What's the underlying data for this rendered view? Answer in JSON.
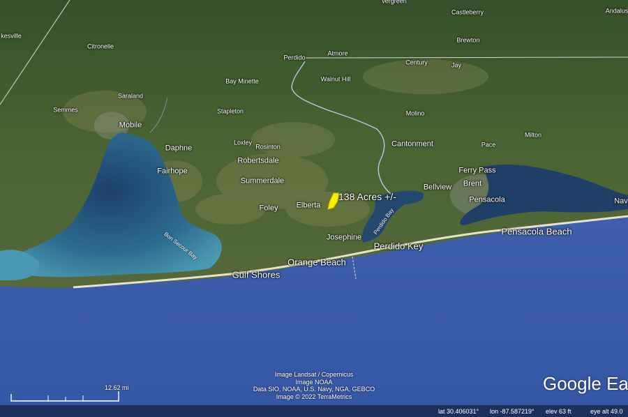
{
  "map": {
    "places": {
      "saraland": "Saraland",
      "semmes": "Semmes",
      "mobile": "Mobile",
      "citronelle": "Citronelle",
      "daphne": "Daphne",
      "fairhope": "Fairhope",
      "bay_minette": "Bay Minette",
      "stapleton": "Stapleton",
      "loxley": "Loxley",
      "rosinton": "Rosinton",
      "robertsdale": "Robertsdale",
      "summerdale": "Summerdale",
      "foley": "Foley",
      "elberta": "Elberta",
      "josephine": "Josephine",
      "orange_beach": "Orange Beach",
      "gulf_shores": "Gulf Shores",
      "perdido_key": "Perdido Key",
      "perdido": "Perdido",
      "atmore": "Atmore",
      "walnut_hill": "Walnut Hill",
      "century": "Century",
      "jay": "Jay",
      "molino": "Molino",
      "cantonment": "Cantonment",
      "milton": "Milton",
      "pace": "Pace",
      "ferry_pass": "Ferry Pass",
      "brent": "Brent",
      "bellview": "Bellview",
      "pensacola": "Pensacola",
      "pensacola_beach": "Pensacola Beach",
      "navarre": "Nav",
      "castleberry": "Castleberry",
      "brewton": "Brewton",
      "andalusia": "Andalus",
      "evergreen": "vergreen",
      "leakesville": "kesville",
      "bon_secour_bay": "Bon Secour Bay",
      "perdido_bay": "Perdido Bay"
    },
    "placemark": {
      "label": "138 Acres +/-",
      "color": "#f4f000"
    },
    "attribution": [
      "Image Landsat / Copernicus",
      "Image NOAA",
      "Data SIO, NOAA, U.S. Navy, NGA, GEBCO",
      "Image © 2022 TerraMetrics"
    ],
    "scale_label": "12.62 mi",
    "logo": "Google Earth"
  },
  "status": {
    "lat": "lat  30.406031°",
    "lon": "lon  -87.587219°",
    "elev": "elev    63 ft",
    "eye": "eye alt  49.0"
  },
  "colors": {
    "ocean": "#3d5fa8",
    "land": "#3f5a2c",
    "bay": "#2a6f8c"
  }
}
